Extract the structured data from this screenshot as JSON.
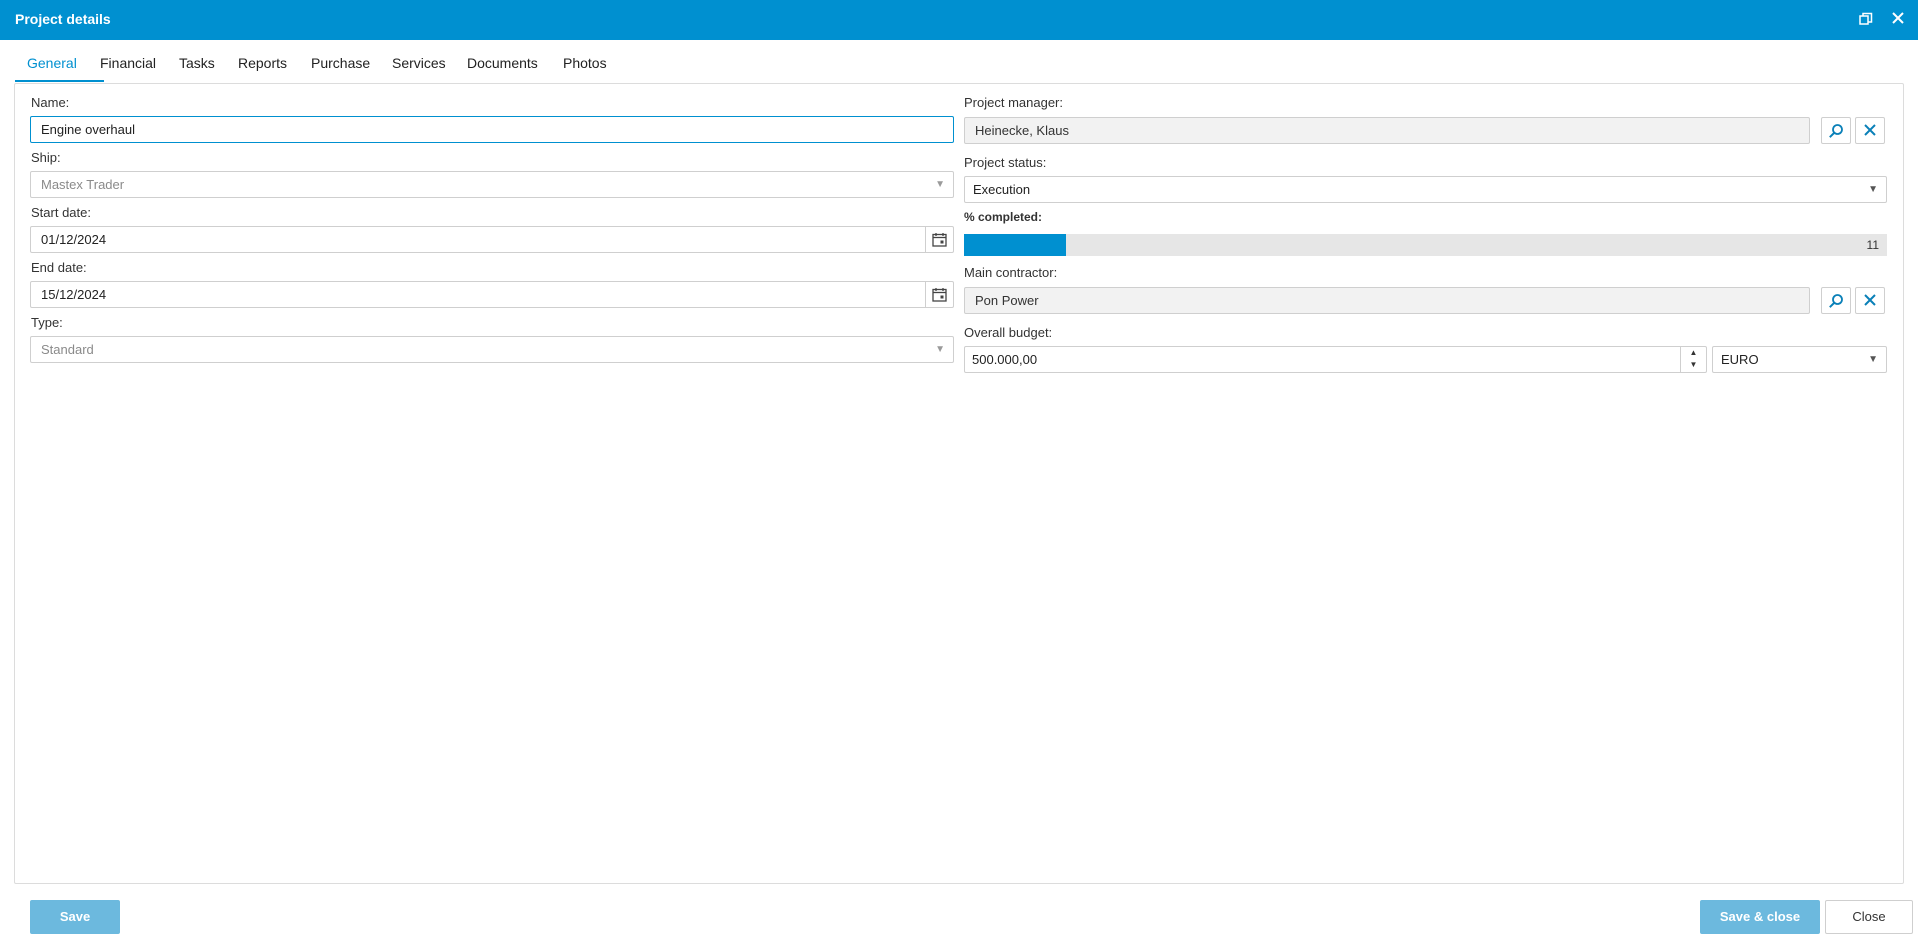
{
  "window": {
    "title": "Project details"
  },
  "tabs": [
    "General",
    "Financial",
    "Tasks",
    "Reports",
    "Purchase",
    "Services",
    "Documents",
    "Photos"
  ],
  "general": {
    "name_label": "Name:",
    "name_value": "Engine overhaul",
    "ship_label": "Ship:",
    "ship_value": "Mastex Trader",
    "start_date_label": "Start date:",
    "start_date_value": "01/12/2024",
    "end_date_label": "End date:",
    "end_date_value": "15/12/2024",
    "type_label": "Type:",
    "type_value": "Standard",
    "manager_label": "Project manager:",
    "manager_value": "Heinecke, Klaus",
    "status_label": "Project status:",
    "status_value": "Execution",
    "completed_label": "% completed:",
    "completed_value": "11",
    "completed_percent": 11,
    "contractor_label": "Main contractor:",
    "contractor_value": "Pon Power",
    "budget_label": "Overall budget:",
    "budget_value": "500.000,00",
    "currency_value": "EURO"
  },
  "footer": {
    "save_label": "Save",
    "save_close_label": "Save & close",
    "close_label": "Close"
  },
  "colors": {
    "accent": "#0090d0",
    "button_disabled": "#6cb9de"
  }
}
